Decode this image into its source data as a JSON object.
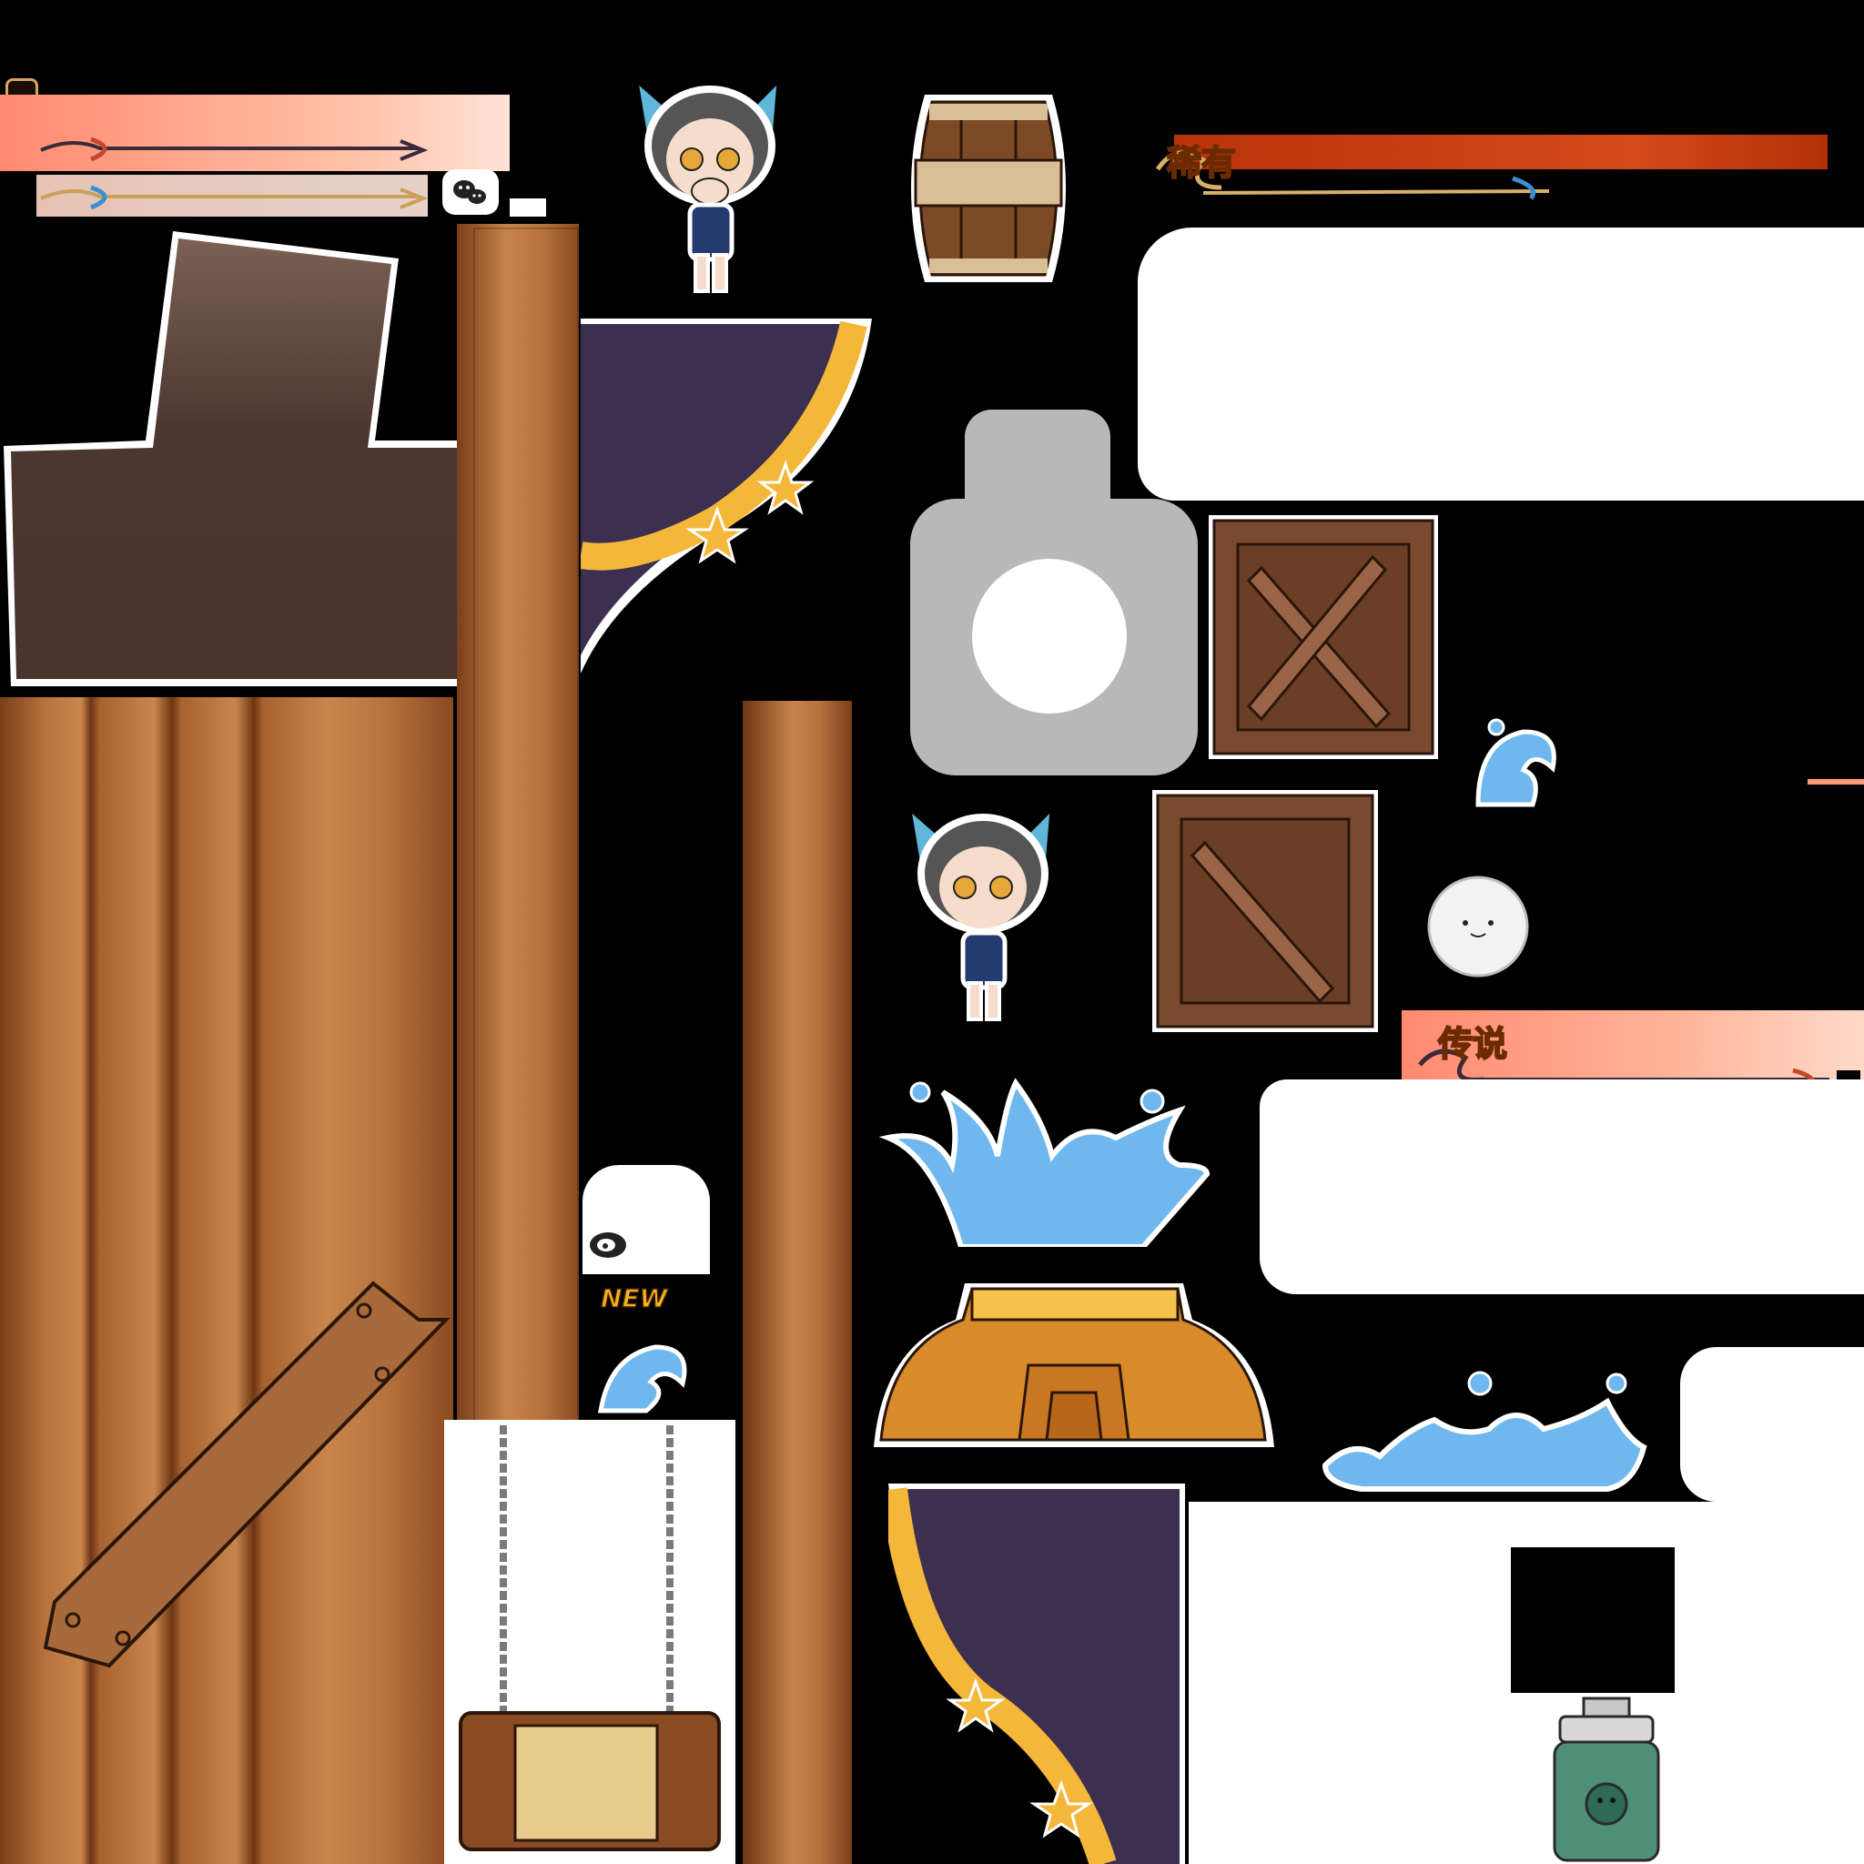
{
  "sprites": {
    "badge_rare": "稀有",
    "badge_legend": "传说",
    "badge_new": "NEW"
  },
  "colors": {
    "wood": "#b8733d",
    "wood_dark": "#6b3a1a",
    "water": "#6fb8ef",
    "curtain": "#3d2f4f",
    "ruffle": "#f4b73a",
    "orange_band": "#ff9a78",
    "red_band": "#c73a12"
  },
  "icons": [
    "wechat-icon",
    "weibo-icon",
    "wave-icon",
    "splash-icon",
    "star-icon",
    "seal-ball-icon",
    "jar-icon"
  ]
}
